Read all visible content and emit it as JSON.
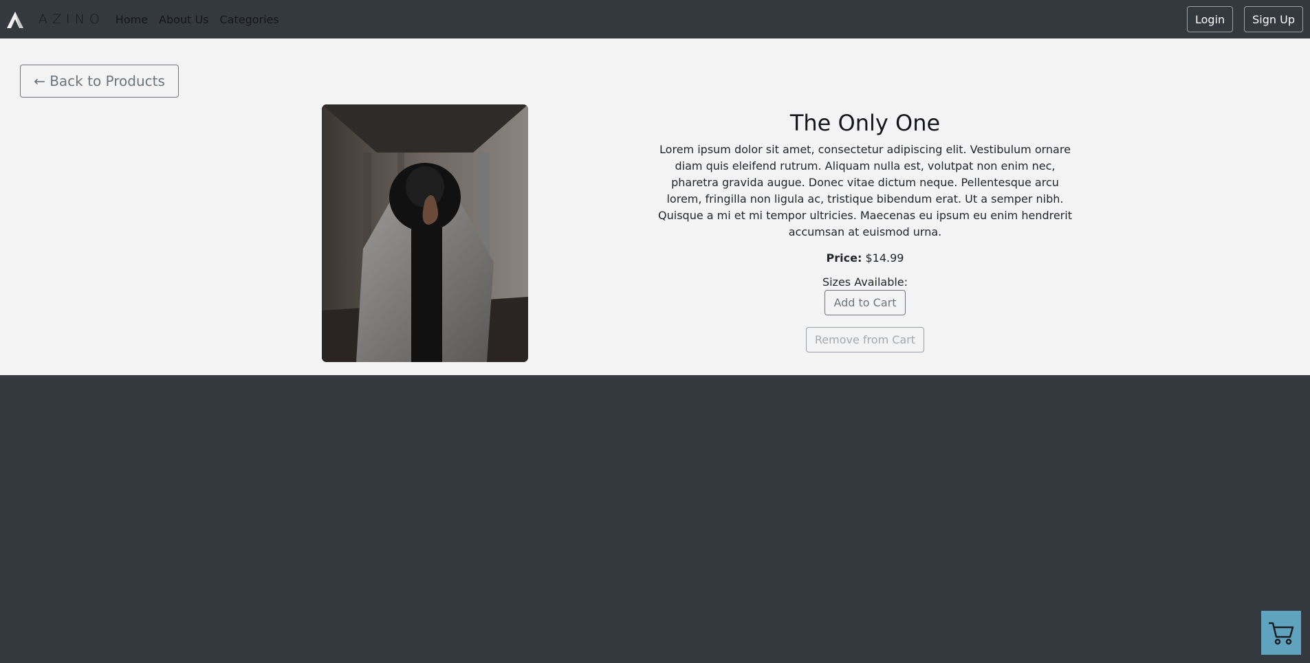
{
  "brand": {
    "name": "AZINO",
    "logo_icon": "azino-logo-icon"
  },
  "nav": {
    "links": [
      {
        "label": "Home"
      },
      {
        "label": "About Us"
      },
      {
        "label": "Categories"
      }
    ],
    "login_label": "Login",
    "signup_label": "Sign Up"
  },
  "page": {
    "back_label": "← Back to Products",
    "product": {
      "title": "The Only One",
      "description": "Lorem ipsum dolor sit amet, consectetur adipiscing elit. Vestibulum ornare diam quis eleifend rutrum. Aliquam nulla est, volutpat non enim nec, pharetra gravida augue. Donec vitae dictum neque. Pellentesque arcu lorem, fringilla non ligula ac, tristique bibendum erat. Ut a semper nibh. Quisque a mi et mi tempor ultricies. Maecenas eu ipsum eu enim hendrerit accumsan at euismod urna.",
      "price_label": "Price:",
      "price_value": "$14.99",
      "sizes_label": "Sizes Available:",
      "add_label": "Add to Cart",
      "remove_label": "Remove from Cart"
    }
  },
  "cart": {
    "icon": "shopping-cart-icon"
  },
  "colors": {
    "background_dark": "#343940",
    "content_bg": "#f4f4f4",
    "cart_button": "#5fa3bf",
    "outline_gray": "#6c757d"
  }
}
